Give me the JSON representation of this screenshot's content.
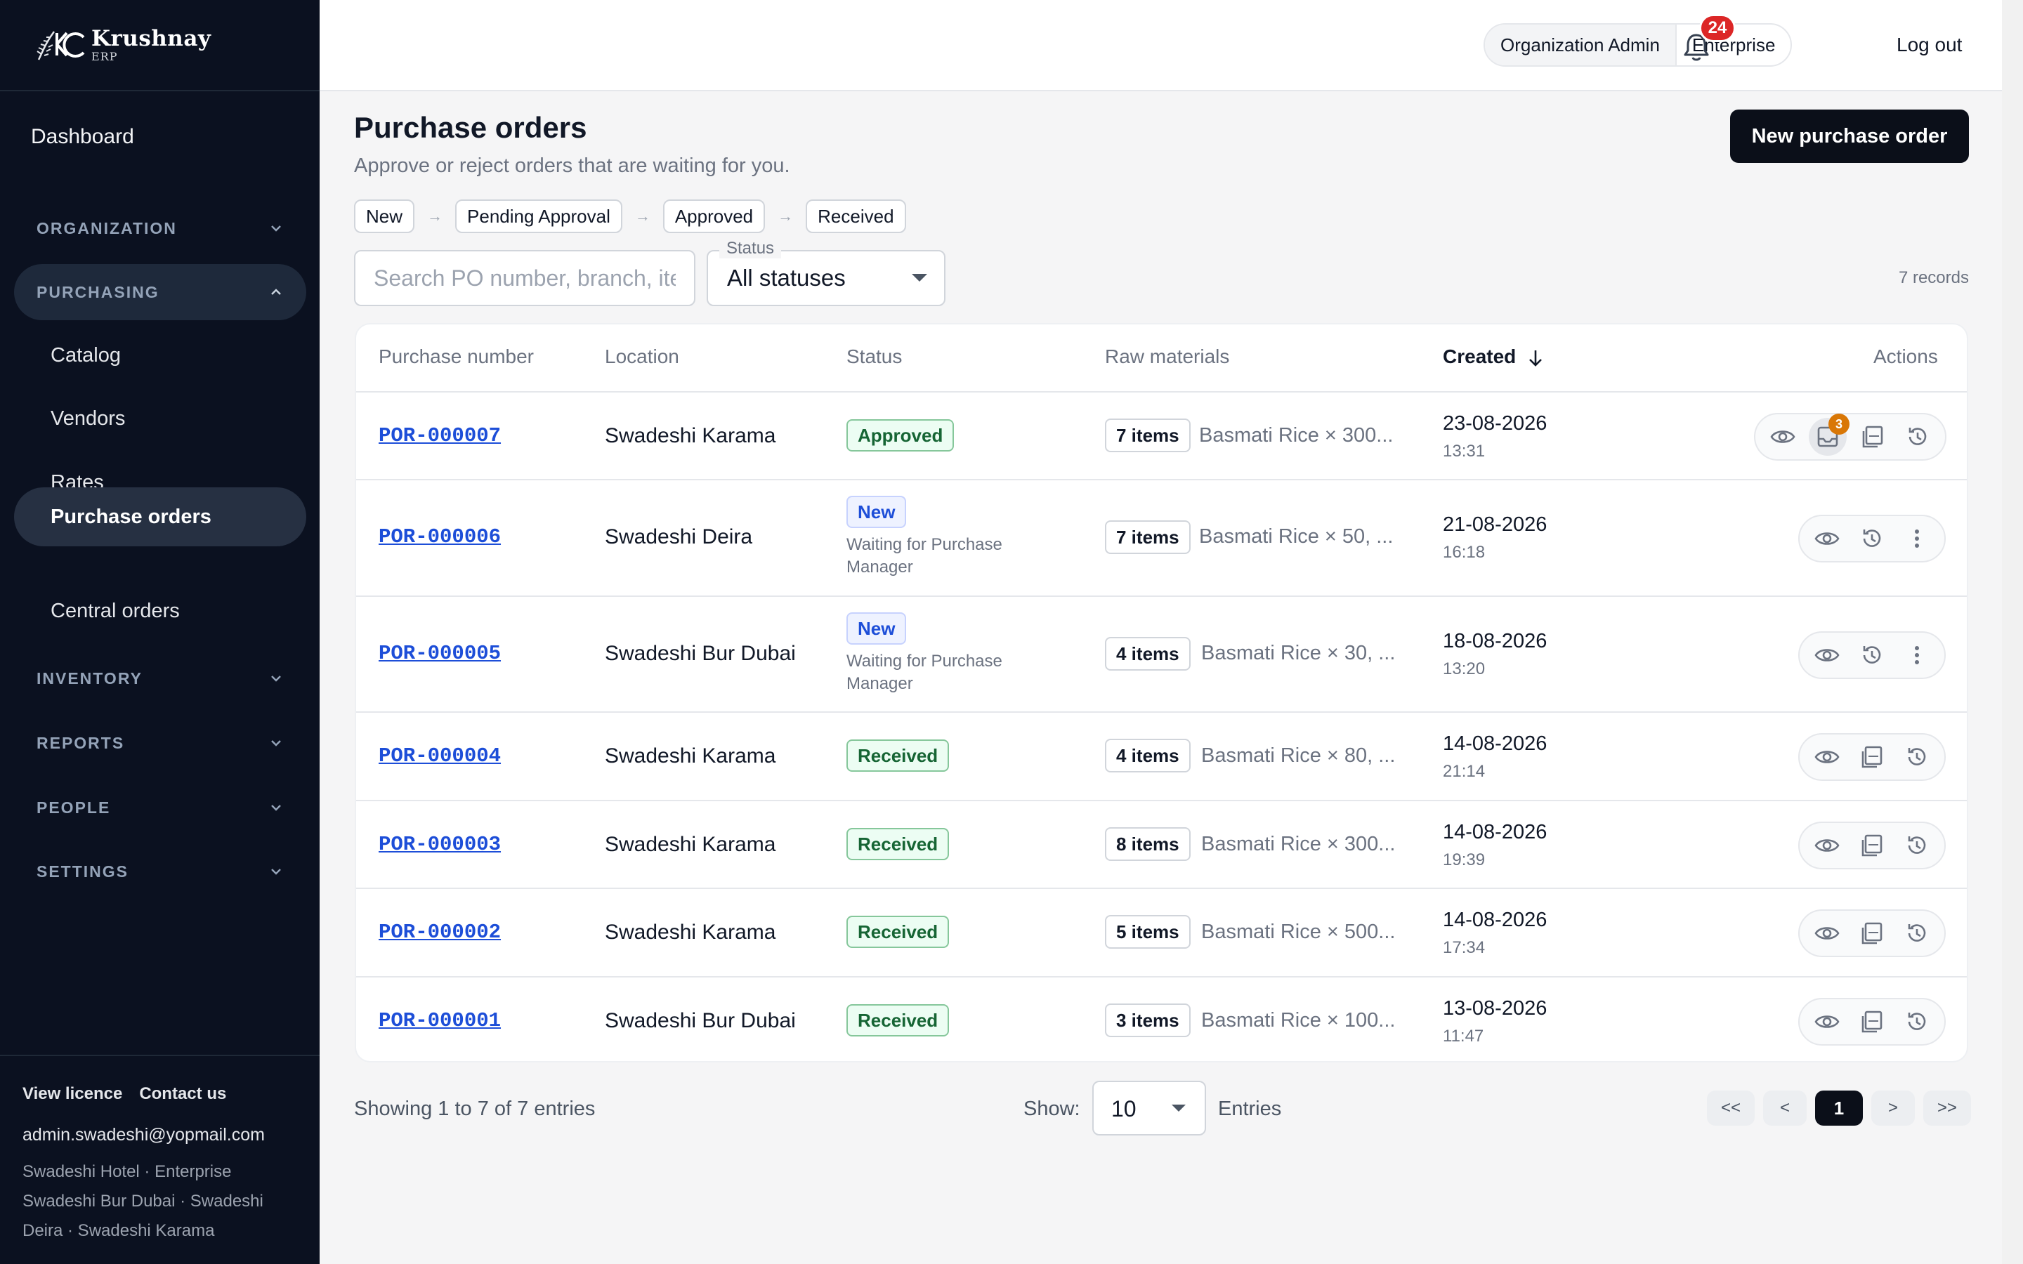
{
  "brand": {
    "name": "Krushnay",
    "sub": "ERP"
  },
  "sidebar": {
    "dashboard": "Dashboard",
    "sections": [
      {
        "label": "ORGANIZATION",
        "state": "collapsed"
      },
      {
        "label": "PURCHASING",
        "state": "expanded"
      },
      {
        "label": "INVENTORY",
        "state": "collapsed"
      },
      {
        "label": "REPORTS",
        "state": "collapsed"
      },
      {
        "label": "PEOPLE",
        "state": "collapsed"
      },
      {
        "label": "SETTINGS",
        "state": "collapsed"
      }
    ],
    "purchasing_items": [
      {
        "label": "Catalog",
        "active": false
      },
      {
        "label": "Vendors",
        "active": false
      },
      {
        "label": "Rates",
        "active": false
      },
      {
        "label": "Purchase orders",
        "active": true
      },
      {
        "label": "Central orders",
        "active": false
      }
    ],
    "footer": {
      "licence": "View licence",
      "contact": "Contact us",
      "email": "admin.swadeshi@yopmail.com",
      "org": "Swadeshi Hotel · Enterprise",
      "branches": "Swadeshi Bur Dubai · Swadeshi Deira · Swadeshi Karama"
    }
  },
  "topbar": {
    "role": "Organization Admin",
    "plan": "Enterprise",
    "notifications": "24",
    "logout": "Log out"
  },
  "page": {
    "title": "Purchase orders",
    "subtitle": "Approve or reject orders that are waiting for you.",
    "new_button": "New purchase order",
    "flow": [
      "New",
      "Pending Approval",
      "Approved",
      "Received"
    ],
    "flow_arrow": "→"
  },
  "filters": {
    "search_placeholder": "Search PO number, branch, item…",
    "status_label": "Status",
    "status_value": "All statuses",
    "records": "7 records"
  },
  "table": {
    "headers": {
      "purchase_number": "Purchase number",
      "location": "Location",
      "status": "Status",
      "raw_materials": "Raw materials",
      "created": "Created",
      "actions": "Actions"
    },
    "rows": [
      {
        "po": "POR-000007",
        "location": "Swadeshi Karama",
        "status": "Approved",
        "note": "",
        "items": "7 items",
        "materials": "Basmati Rice × 300...",
        "date": "23-08-2026",
        "time": "13:31",
        "actions": [
          "view",
          "receive",
          "pdf",
          "history"
        ],
        "receive_badge": "3"
      },
      {
        "po": "POR-000006",
        "location": "Swadeshi Deira",
        "status": "New",
        "note": "Waiting for Purchase Manager",
        "items": "7 items",
        "materials": "Basmati Rice × 50, ...",
        "date": "21-08-2026",
        "time": "16:18",
        "actions": [
          "view",
          "history",
          "more"
        ]
      },
      {
        "po": "POR-000005",
        "location": "Swadeshi Bur Dubai",
        "status": "New",
        "note": "Waiting for Purchase Manager",
        "items": "4 items",
        "materials": "Basmati Rice × 30, ...",
        "date": "18-08-2026",
        "time": "13:20",
        "actions": [
          "view",
          "history",
          "more"
        ]
      },
      {
        "po": "POR-000004",
        "location": "Swadeshi Karama",
        "status": "Received",
        "note": "",
        "items": "4 items",
        "materials": "Basmati Rice × 80, ...",
        "date": "14-08-2026",
        "time": "21:14",
        "actions": [
          "view",
          "pdf",
          "history"
        ]
      },
      {
        "po": "POR-000003",
        "location": "Swadeshi Karama",
        "status": "Received",
        "note": "",
        "items": "8 items",
        "materials": "Basmati Rice × 300...",
        "date": "14-08-2026",
        "time": "19:39",
        "actions": [
          "view",
          "pdf",
          "history"
        ]
      },
      {
        "po": "POR-000002",
        "location": "Swadeshi Karama",
        "status": "Received",
        "note": "",
        "items": "5 items",
        "materials": "Basmati Rice × 500...",
        "date": "14-08-2026",
        "time": "17:34",
        "actions": [
          "view",
          "pdf",
          "history"
        ]
      },
      {
        "po": "POR-000001",
        "location": "Swadeshi Bur Dubai",
        "status": "Received",
        "note": "",
        "items": "3 items",
        "materials": "Basmati Rice × 100...",
        "date": "13-08-2026",
        "time": "11:47",
        "actions": [
          "view",
          "pdf",
          "history"
        ]
      }
    ]
  },
  "pagination": {
    "showing": "Showing 1 to 7 of 7 entries",
    "show_label": "Show:",
    "page_size": "10",
    "entries_label": "Entries",
    "first": "<<",
    "prev": "<",
    "current": "1",
    "next": ">",
    "last": ">>"
  },
  "colors": {
    "sidebar_bg": "#0b1120",
    "accent_dark": "#0b0f19",
    "link": "#1d4ed8",
    "received_green": "#166534",
    "new_blue": "#1d4ed8",
    "notification_red": "#dc2626",
    "receive_badge_amber": "#d97706"
  }
}
